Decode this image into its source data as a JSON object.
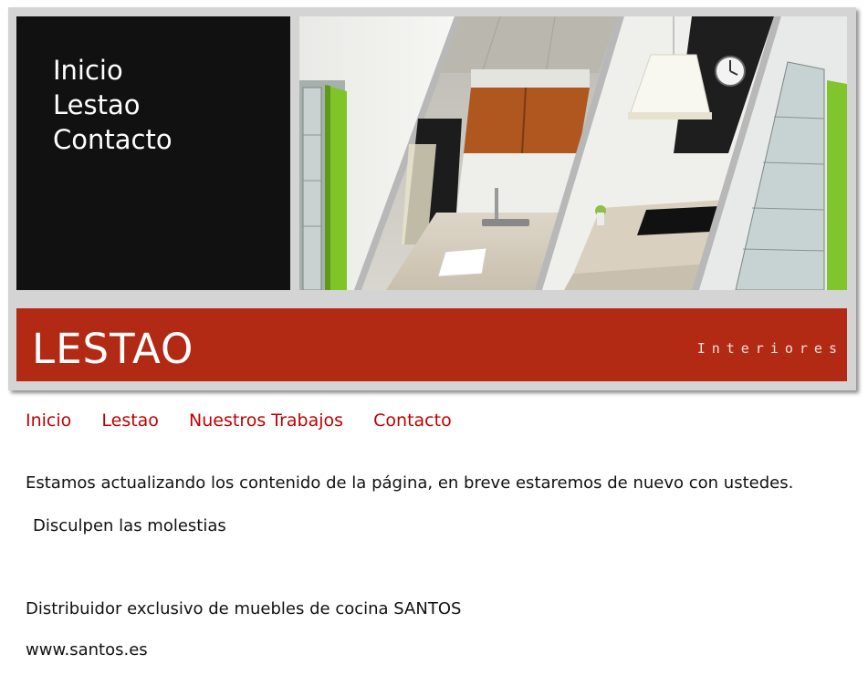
{
  "side_menu": {
    "items": [
      {
        "label": "Inicio"
      },
      {
        "label": "Lestao"
      },
      {
        "label": "Contacto"
      }
    ]
  },
  "banner": {
    "brand": "LESTAO",
    "tagline": "Interiores",
    "color": "#b22a14"
  },
  "photos": [
    {
      "subject": "kitchen-cabinet-with-green-door"
    },
    {
      "subject": "kitchen-countertop-with-sink"
    },
    {
      "subject": "kitchen-with-hob-and-pendant-lamp"
    },
    {
      "subject": "glass-display-cabinet"
    }
  ],
  "nav": {
    "items": [
      {
        "label": "Inicio"
      },
      {
        "label": "Lestao"
      },
      {
        "label": "Nuestros Trabajos"
      },
      {
        "label": "Contacto"
      }
    ],
    "link_color": "#c00000"
  },
  "content": {
    "message": "Estamos actualizando los contenido de la página, en breve estaremos de nuevo con ustedes.",
    "apology": "Disculpen las molestias",
    "distributor": "Distribuidor exclusivo de muebles de cocina SANTOS",
    "website": "www.santos.es"
  }
}
